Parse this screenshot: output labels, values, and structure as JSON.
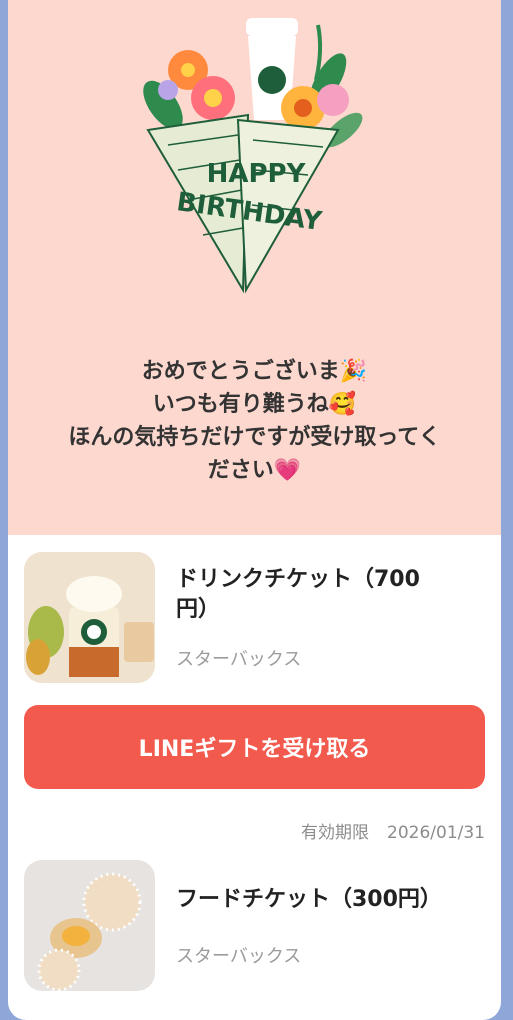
{
  "banner": {
    "illustration_text": [
      "HAPPY",
      "BIRTHDAY"
    ],
    "message_lines": [
      "おめでとうございま",
      "いつも有り難うね",
      "ほんの気持ちだけですが受け取ってく",
      "ださい"
    ],
    "message_emojis": [
      "🎉",
      "🥰",
      "💗"
    ],
    "background_color": "#fdd8cf"
  },
  "tickets": [
    {
      "title": "ドリンクチケット（700円）",
      "title_line1": "ドリンクチケット（700",
      "title_line2": "円）",
      "brand": "スターバックス",
      "image": "frappuccino-drink"
    },
    {
      "title": "フードチケット（300円）",
      "brand": "スターバックス",
      "image": "pastry-food"
    }
  ],
  "cta": {
    "label": "LINEギフトを受け取る",
    "color": "#f25a4d"
  },
  "expiry": {
    "label": "有効期限",
    "date": "2026/01/31"
  }
}
